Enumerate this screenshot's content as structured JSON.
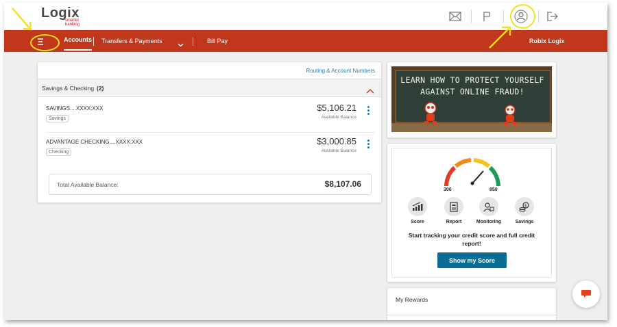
{
  "brand": {
    "logo_main": "Logix",
    "logo_tag": "smarter\nbanking"
  },
  "nav": {
    "accounts": "Accounts",
    "transfers": "Transfers & Payments",
    "bill_pay": "Bill Pay",
    "user_name": "Robix Logix"
  },
  "accounts_card": {
    "routing_link": "Routing & Account Numbers",
    "section_title": "Savings & Checking",
    "section_count": "(2)",
    "accounts": [
      {
        "name": "SAVINGS....XXXX:XXX",
        "type": "Savings",
        "balance": "$5,106.21",
        "balance_label": "Available Balance"
      },
      {
        "name": "ADVANTAGE CHECKING....XXXX:XXX",
        "type": "Checking",
        "balance": "$3,000.85",
        "balance_label": "Available Balance"
      }
    ],
    "total_label": "Total Available Balance:",
    "total_value": "$8,107.06"
  },
  "banner": {
    "text": "LEARN HOW TO PROTECT YOURSELF AGAINST ONLINE FRAUD!"
  },
  "credit": {
    "gauge_min": "300",
    "gauge_max": "850",
    "features": [
      {
        "label": "Score",
        "icon": "bar-chart-icon"
      },
      {
        "label": "Report",
        "icon": "report-icon"
      },
      {
        "label": "Monitoring",
        "icon": "monitoring-icon"
      },
      {
        "label": "Savings",
        "icon": "savings-icon"
      }
    ],
    "message": "Start tracking your credit score and full credit report!",
    "button": "Show my Score"
  },
  "rewards": {
    "title": "My Rewards"
  },
  "colors": {
    "nav": "#c0371b",
    "accent": "#1d7fae",
    "button": "#0b6c96",
    "highlight": "#f1e21a",
    "chat": "#e8401c"
  }
}
